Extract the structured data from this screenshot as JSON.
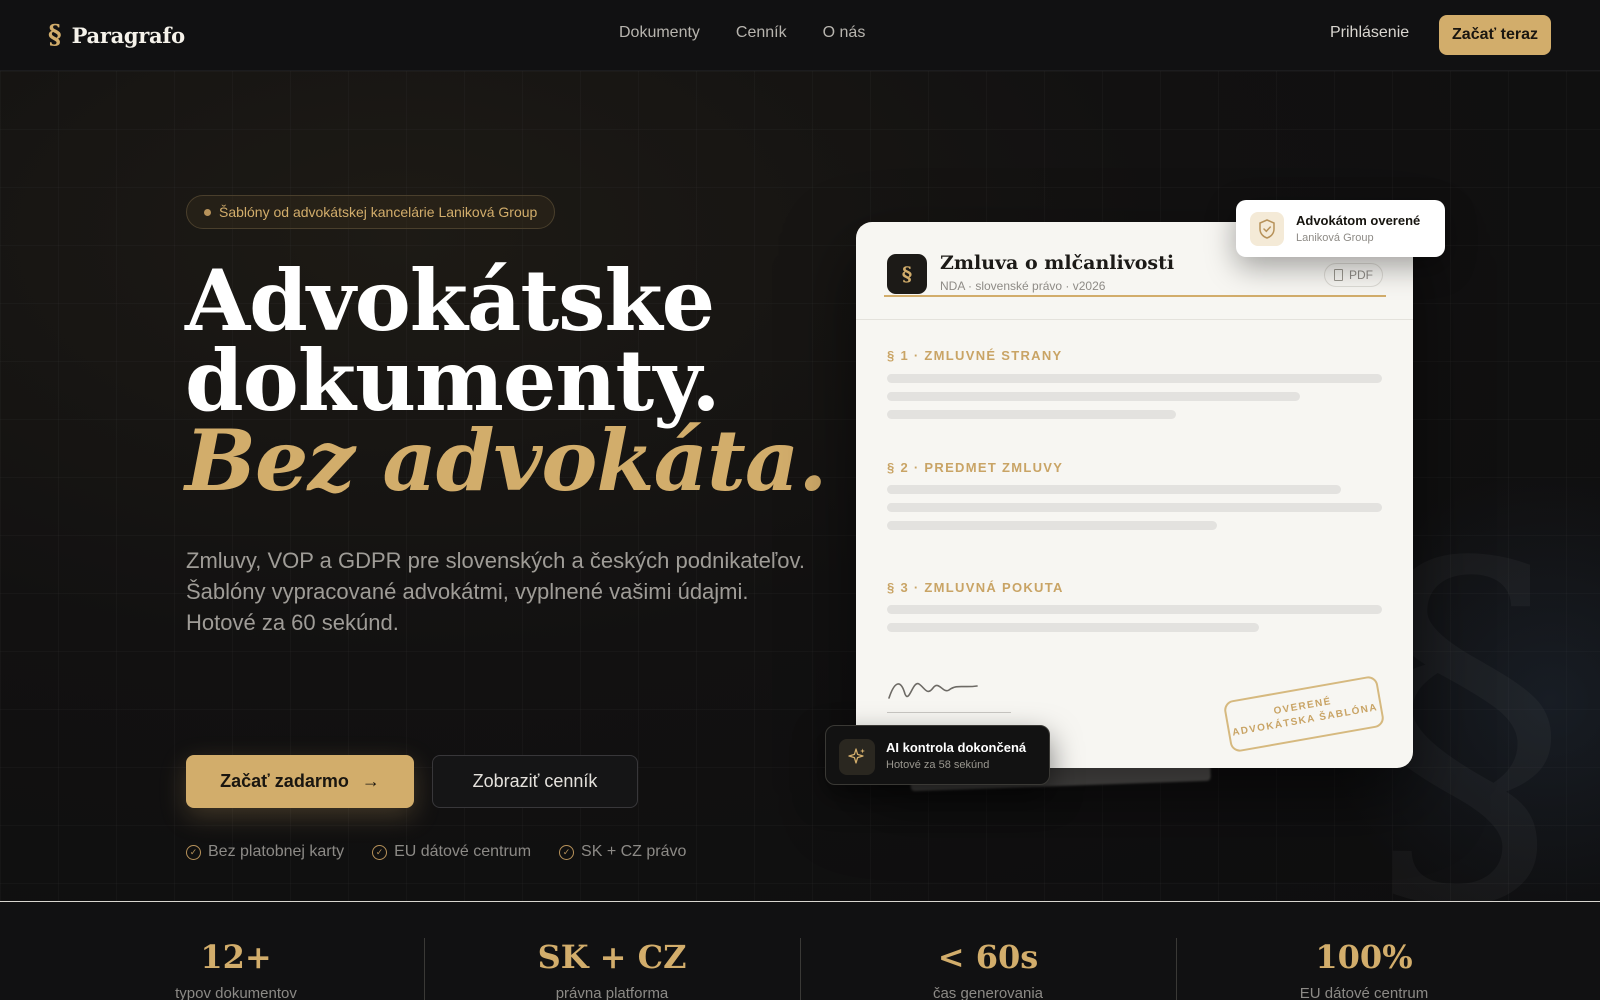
{
  "brand": {
    "mark": "§",
    "name": "Paragrafo"
  },
  "nav": {
    "links": [
      "Dokumenty",
      "Cenník",
      "O nás"
    ],
    "login": "Prihlásenie",
    "cta": "Začať teraz"
  },
  "hero": {
    "badge": "Šablóny od advokátskej kancelárie Laniková Group",
    "headline": {
      "line1": "Advokátske",
      "line2": "dokumenty.",
      "line3": "Bez advokáta."
    },
    "lead": "Zmluvy, VOP a GDPR pre slovenských a českých podnikateľov. Šablóny vypracované advokátmi, vyplnené vašimi údajmi. Hotové za 60 sekúnd.",
    "primary_button": "Začať zadarmo",
    "primary_icon": "arrow-right-icon",
    "secondary_button": "Zobraziť cenník",
    "checks": [
      "Bez platobnej karty",
      "EU dátové centrum",
      "SK + CZ právo"
    ]
  },
  "document": {
    "logo": "§",
    "title": "Zmluva o mlčanlivosti",
    "subtitle": "NDA · slovenské právo · v2026",
    "pdf_label": "PDF",
    "sections": [
      "§ 1 · ZMLUVNÉ STRANY",
      "§ 2 · PREDMET ZMLUVY",
      "§ 3 · ZMLUVNÁ POKUTA"
    ],
    "stamp_line1": "OVERENÉ",
    "stamp_line2": "ADVOKÁTSKA ŠABLÓNA"
  },
  "verified_card": {
    "title": "Advokátom overené",
    "subtitle": "Laniková Group",
    "icon": "shield-check-icon"
  },
  "ai_card": {
    "title": "AI kontrola dokončená",
    "subtitle": "Hotové za 58 sekúnd",
    "icon": "sparkle-icon"
  },
  "stats": [
    {
      "value": "12+",
      "label": "typov dokumentov"
    },
    {
      "value": "SK + CZ",
      "label": "právna platforma"
    },
    {
      "value": "< 60s",
      "label": "čas generovania"
    },
    {
      "value": "100%",
      "label": "EU dátové centrum"
    }
  ],
  "colors": {
    "accent": "#d2ad6b",
    "background": "#0f0f10",
    "paper": "#f7f6f2"
  }
}
